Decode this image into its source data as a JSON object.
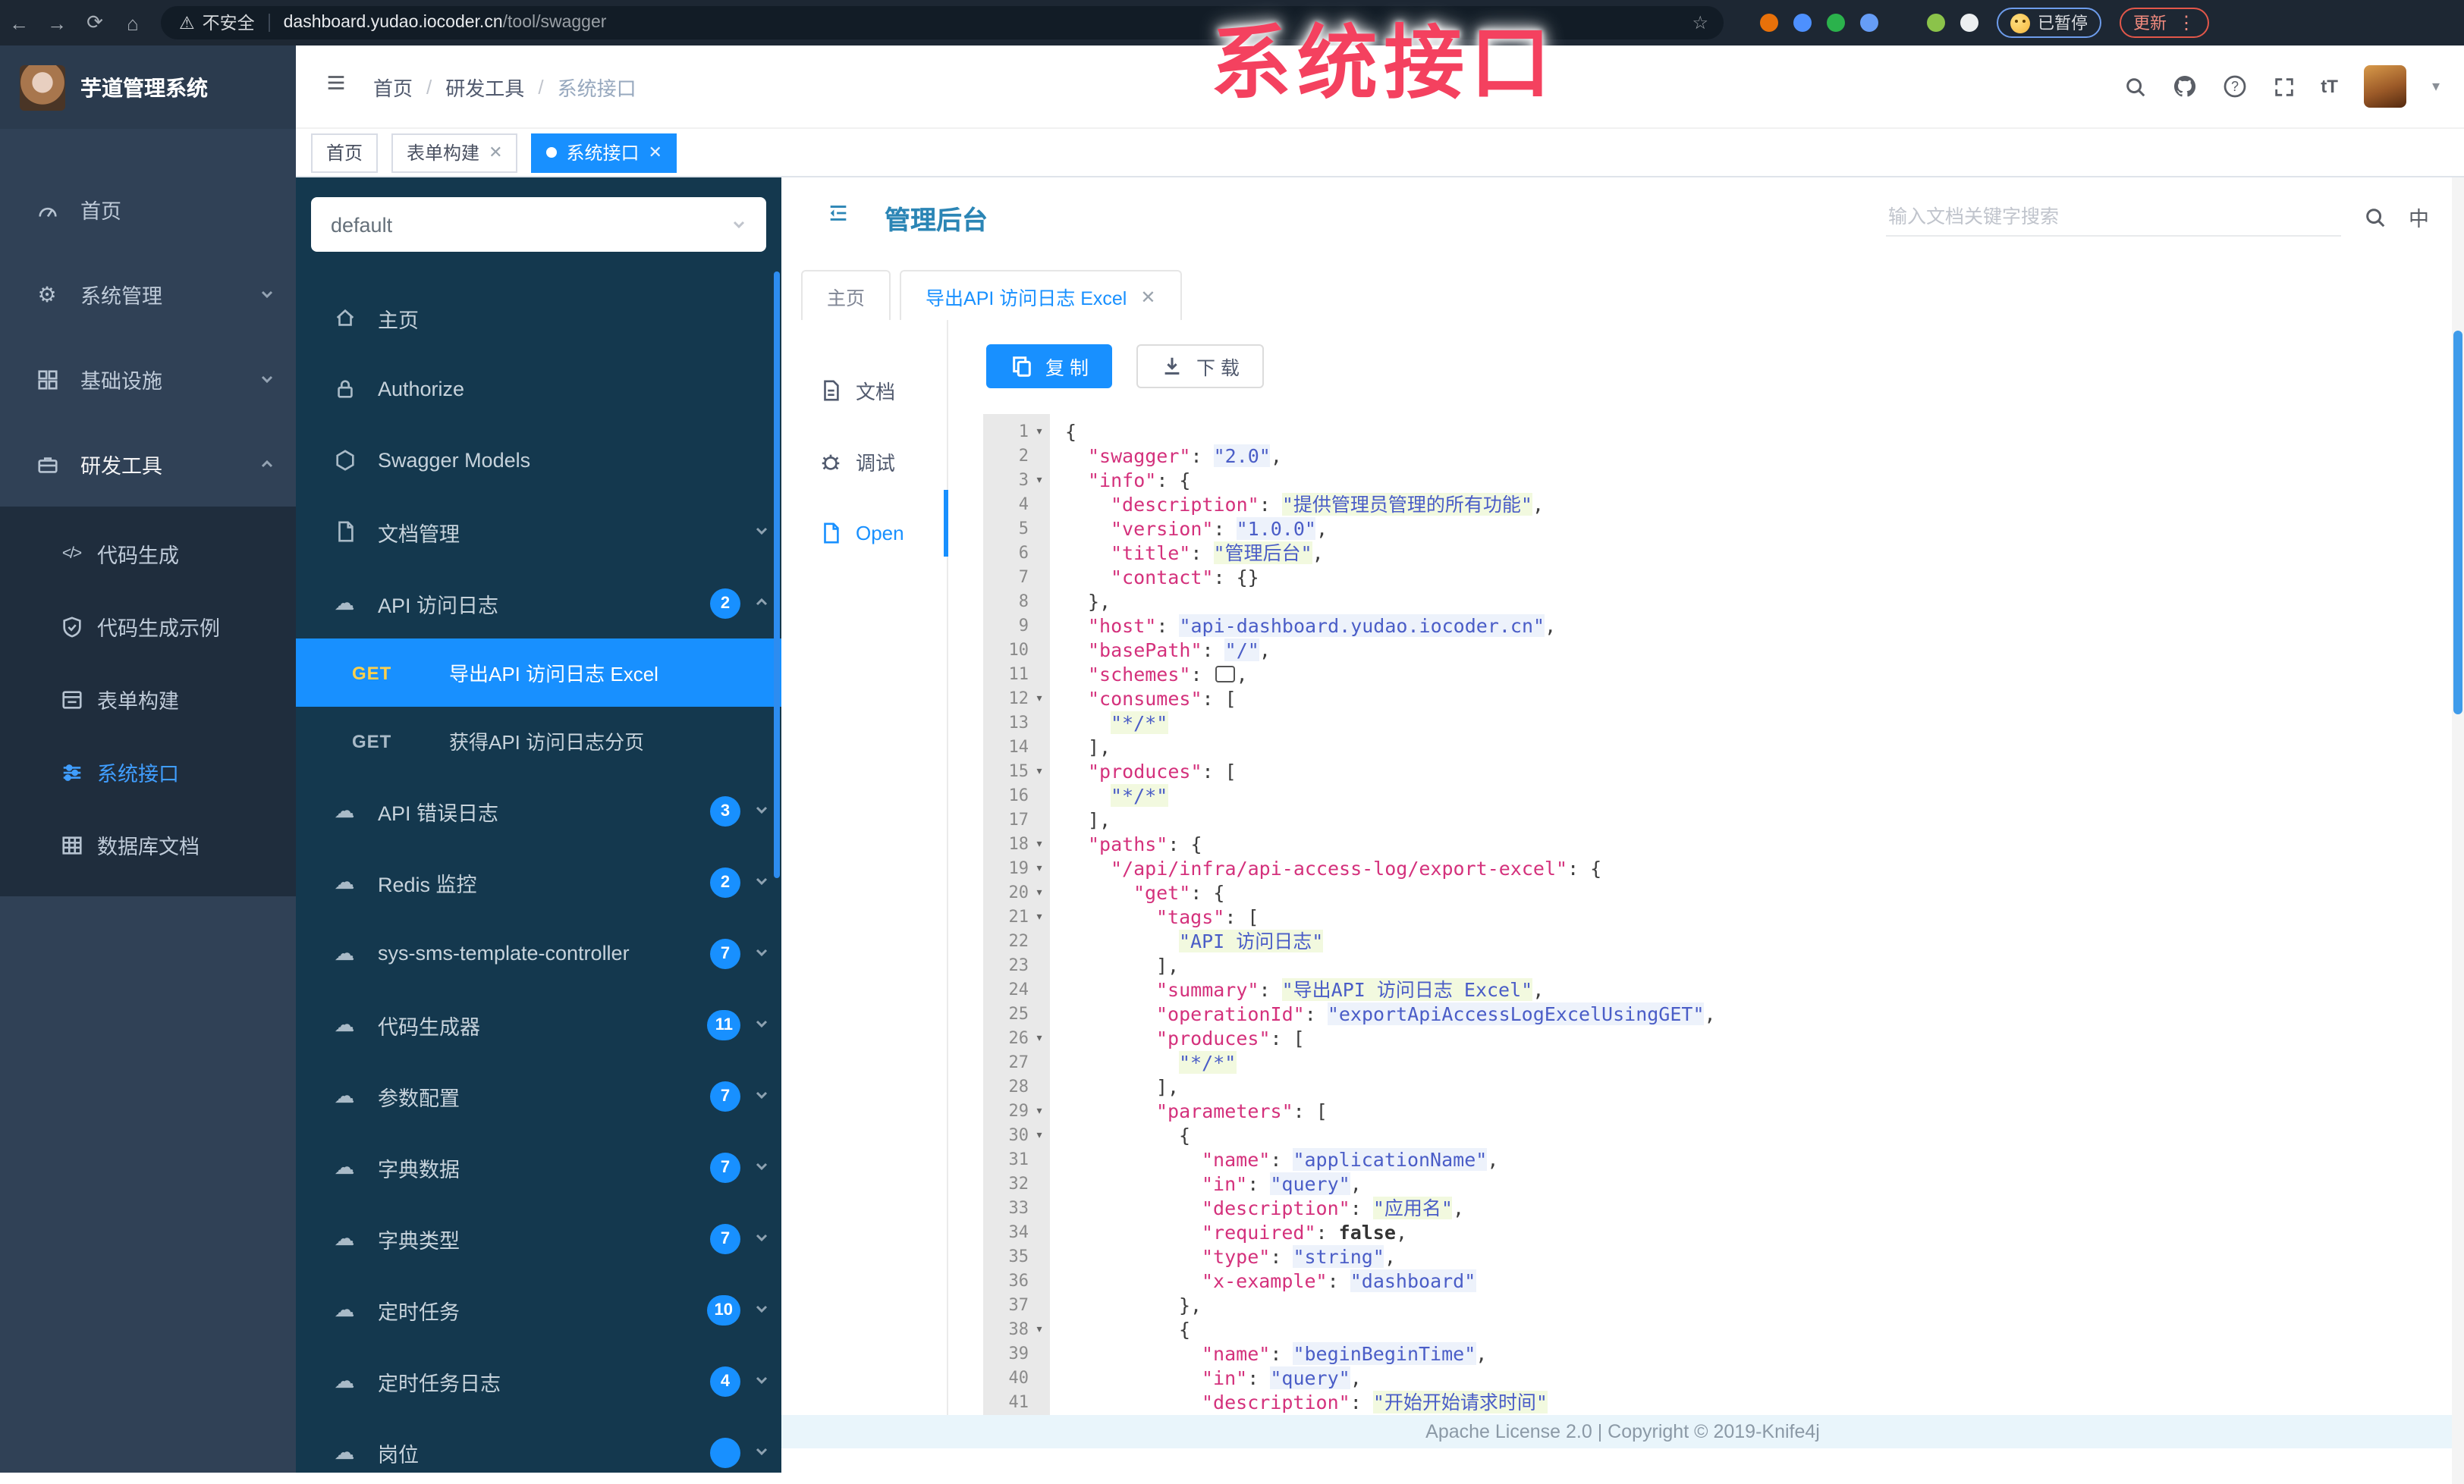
{
  "watermark": "系统接口",
  "colors": {
    "accent": "#1890ff",
    "sidebar_bg": "#304156",
    "submenu_bg": "#1f2d3d",
    "swagger_sidebar_bg": "#14384e",
    "selected_method_text": "#ffd04b",
    "title_teal": "#2b85b5",
    "footer_bg": "#e9f5fb",
    "watermark_pink": "#f4415f",
    "code_key": "#d4317c",
    "code_string": "#4a5dc7"
  },
  "browser": {
    "security_label": "不安全",
    "url_host": "dashboard.yudao.iocoder.cn",
    "url_path": "/tool/swagger",
    "paused_label": "已暂停",
    "update_label": "更新",
    "extensions": [
      {
        "name": "extension-orange-icon",
        "color": "#e8710a"
      },
      {
        "name": "extension-location-icon",
        "color": "#4d90fe"
      },
      {
        "name": "extension-green-ring-icon",
        "color": "#2bb24c"
      },
      {
        "name": "extension-grid-icon",
        "color": "#669df6"
      },
      {
        "name": "extension-green-badge-icon",
        "color": "#12ب886"
      },
      {
        "name": "extension-leaf-icon",
        "color": "#8bc34a"
      },
      {
        "name": "extension-ghost-icon",
        "color": "#eceff1"
      }
    ]
  },
  "app_header": {
    "logo_title": "芋道管理系统",
    "breadcrumb": [
      "首页",
      "研发工具",
      "系统接口"
    ]
  },
  "page_tabs": [
    {
      "label": "首页",
      "closable": false,
      "active": false
    },
    {
      "label": "表单构建",
      "closable": true,
      "active": false
    },
    {
      "label": "系统接口",
      "closable": true,
      "active": true
    }
  ],
  "sidebar": {
    "items": [
      {
        "icon": "dashboard-icon",
        "label": "首页"
      },
      {
        "icon": "gear-icon",
        "label": "系统管理",
        "chevron": "down"
      },
      {
        "icon": "grid-icon",
        "label": "基础设施",
        "chevron": "down"
      },
      {
        "icon": "toolbox-icon",
        "label": "研发工具",
        "chevron": "up",
        "active": true
      }
    ],
    "sub_items": [
      {
        "icon": "code-icon",
        "label": "代码生成"
      },
      {
        "icon": "shield-icon",
        "label": "代码生成示例"
      },
      {
        "icon": "form-icon",
        "label": "表单构建"
      },
      {
        "icon": "sliders-icon",
        "label": "系统接口",
        "active": true
      },
      {
        "icon": "table-icon",
        "label": "数据库文档"
      }
    ]
  },
  "swagger": {
    "group_select": "default",
    "menu": [
      {
        "type": "item",
        "icon": "house-icon",
        "label": "主页"
      },
      {
        "type": "item",
        "icon": "lock-icon",
        "label": "Authorize"
      },
      {
        "type": "item",
        "icon": "models-icon",
        "label": "Swagger Models"
      },
      {
        "type": "item",
        "icon": "file-icon",
        "label": "文档管理",
        "chevron": "down"
      },
      {
        "type": "group",
        "icon": "cloud-icon",
        "label": "API 访问日志",
        "badge": "2",
        "chevron": "up"
      },
      {
        "type": "op",
        "method": "GET",
        "label": "导出API 访问日志 Excel",
        "active": true
      },
      {
        "type": "op",
        "method": "GET",
        "label": "获得API 访问日志分页"
      },
      {
        "type": "group",
        "icon": "cloud-icon",
        "label": "API 错误日志",
        "badge": "3",
        "chevron": "down"
      },
      {
        "type": "group",
        "icon": "cloud-icon",
        "label": "Redis 监控",
        "badge": "2",
        "chevron": "down"
      },
      {
        "type": "group",
        "icon": "cloud-icon",
        "label": "sys-sms-template-controller",
        "badge": "7",
        "chevron": "down"
      },
      {
        "type": "group",
        "icon": "cloud-icon",
        "label": "代码生成器",
        "badge": "11",
        "chevron": "down"
      },
      {
        "type": "group",
        "icon": "cloud-icon",
        "label": "参数配置",
        "badge": "7",
        "chevron": "down"
      },
      {
        "type": "group",
        "icon": "cloud-icon",
        "label": "字典数据",
        "badge": "7",
        "chevron": "down"
      },
      {
        "type": "group",
        "icon": "cloud-icon",
        "label": "字典类型",
        "badge": "7",
        "chevron": "down"
      },
      {
        "type": "group",
        "icon": "cloud-icon",
        "label": "定时任务",
        "badge": "10",
        "chevron": "down"
      },
      {
        "type": "group",
        "icon": "cloud-icon",
        "label": "定时任务日志",
        "badge": "4",
        "chevron": "down"
      },
      {
        "type": "group",
        "icon": "cloud-icon",
        "label": "岗位",
        "badge": "",
        "chevron": "down"
      }
    ]
  },
  "content": {
    "title": "管理后台",
    "search_placeholder": "输入文档关键字搜索",
    "lang": "中",
    "tabs": [
      {
        "label": "主页",
        "closable": false,
        "active": false
      },
      {
        "label": "导出API 访问日志 Excel",
        "closable": true,
        "active": true
      }
    ],
    "doc_tabs": [
      {
        "icon": "doc-icon",
        "label": "文档",
        "active": false
      },
      {
        "icon": "debug-icon",
        "label": "调试",
        "active": false
      },
      {
        "icon": "open-icon",
        "label": "Open",
        "active": true
      }
    ],
    "toolbar": {
      "copy_label": "复 制",
      "download_label": "下 载"
    }
  },
  "code": {
    "lines": [
      {
        "n": 1,
        "i": 0,
        "f": 1,
        "s": [
          [
            "p",
            "{"
          ]
        ]
      },
      {
        "n": 2,
        "i": 1,
        "s": [
          [
            "k",
            "\"swagger\""
          ],
          [
            "p",
            ": "
          ],
          [
            "s",
            "\"2.0\""
          ],
          [
            "p",
            ","
          ]
        ]
      },
      {
        "n": 3,
        "i": 1,
        "f": 1,
        "s": [
          [
            "k",
            "\"info\""
          ],
          [
            "p",
            ": {"
          ]
        ]
      },
      {
        "n": 4,
        "i": 2,
        "s": [
          [
            "k",
            "\"description\""
          ],
          [
            "p",
            ": "
          ],
          [
            "s",
            "\"提供管理员管理的所有功能\""
          ],
          [
            "p",
            ","
          ]
        ]
      },
      {
        "n": 5,
        "i": 2,
        "s": [
          [
            "k",
            "\"version\""
          ],
          [
            "p",
            ": "
          ],
          [
            "s",
            "\"1.0.0\""
          ],
          [
            "p",
            ","
          ]
        ]
      },
      {
        "n": 6,
        "i": 2,
        "s": [
          [
            "k",
            "\"title\""
          ],
          [
            "p",
            ": "
          ],
          [
            "s",
            "\"管理后台\""
          ],
          [
            "p",
            ","
          ]
        ]
      },
      {
        "n": 7,
        "i": 2,
        "s": [
          [
            "k",
            "\"contact\""
          ],
          [
            "p",
            ": {}"
          ]
        ]
      },
      {
        "n": 8,
        "i": 1,
        "s": [
          [
            "p",
            "},"
          ]
        ]
      },
      {
        "n": 9,
        "i": 1,
        "s": [
          [
            "k",
            "\"host\""
          ],
          [
            "p",
            ": "
          ],
          [
            "s",
            "\"api-dashboard.yudao.iocoder.cn\""
          ],
          [
            "p",
            ","
          ]
        ]
      },
      {
        "n": 10,
        "i": 1,
        "s": [
          [
            "k",
            "\"basePath\""
          ],
          [
            "p",
            ": "
          ],
          [
            "s",
            "\"/\""
          ],
          [
            "p",
            ","
          ]
        ]
      },
      {
        "n": 11,
        "i": 1,
        "s": [
          [
            "k",
            "\"schemes\""
          ],
          [
            "p",
            ": "
          ],
          [
            "box",
            ""
          ],
          [
            "p",
            ","
          ]
        ]
      },
      {
        "n": 12,
        "i": 1,
        "f": 1,
        "s": [
          [
            "k",
            "\"consumes\""
          ],
          [
            "p",
            ": ["
          ]
        ]
      },
      {
        "n": 13,
        "i": 2,
        "s": [
          [
            "s",
            "\"*/*\""
          ]
        ]
      },
      {
        "n": 14,
        "i": 1,
        "s": [
          [
            "p",
            "],"
          ]
        ]
      },
      {
        "n": 15,
        "i": 1,
        "f": 1,
        "s": [
          [
            "k",
            "\"produces\""
          ],
          [
            "p",
            ": ["
          ]
        ]
      },
      {
        "n": 16,
        "i": 2,
        "s": [
          [
            "s",
            "\"*/*\""
          ]
        ]
      },
      {
        "n": 17,
        "i": 1,
        "s": [
          [
            "p",
            "],"
          ]
        ]
      },
      {
        "n": 18,
        "i": 1,
        "f": 1,
        "s": [
          [
            "k",
            "\"paths\""
          ],
          [
            "p",
            ": {"
          ]
        ]
      },
      {
        "n": 19,
        "i": 2,
        "f": 1,
        "s": [
          [
            "k",
            "\"/api/infra/api-access-log/export-excel\""
          ],
          [
            "p",
            ": {"
          ]
        ]
      },
      {
        "n": 20,
        "i": 3,
        "f": 1,
        "s": [
          [
            "k",
            "\"get\""
          ],
          [
            "p",
            ": {"
          ]
        ]
      },
      {
        "n": 21,
        "i": 4,
        "f": 1,
        "s": [
          [
            "k",
            "\"tags\""
          ],
          [
            "p",
            ": ["
          ]
        ]
      },
      {
        "n": 22,
        "i": 5,
        "s": [
          [
            "s",
            "\"API 访问日志\""
          ]
        ]
      },
      {
        "n": 23,
        "i": 4,
        "s": [
          [
            "p",
            "],"
          ]
        ]
      },
      {
        "n": 24,
        "i": 4,
        "s": [
          [
            "k",
            "\"summary\""
          ],
          [
            "p",
            ": "
          ],
          [
            "s",
            "\"导出API 访问日志 Excel\""
          ],
          [
            "p",
            ","
          ]
        ]
      },
      {
        "n": 25,
        "i": 4,
        "s": [
          [
            "k",
            "\"operationId\""
          ],
          [
            "p",
            ": "
          ],
          [
            "s",
            "\"exportApiAccessLogExcelUsingGET\""
          ],
          [
            "p",
            ","
          ]
        ]
      },
      {
        "n": 26,
        "i": 4,
        "f": 1,
        "s": [
          [
            "k",
            "\"produces\""
          ],
          [
            "p",
            ": ["
          ]
        ]
      },
      {
        "n": 27,
        "i": 5,
        "s": [
          [
            "s",
            "\"*/*\""
          ]
        ]
      },
      {
        "n": 28,
        "i": 4,
        "s": [
          [
            "p",
            "],"
          ]
        ]
      },
      {
        "n": 29,
        "i": 4,
        "f": 1,
        "s": [
          [
            "k",
            "\"parameters\""
          ],
          [
            "p",
            ": ["
          ]
        ]
      },
      {
        "n": 30,
        "i": 5,
        "f": 1,
        "s": [
          [
            "p",
            "{"
          ]
        ]
      },
      {
        "n": 31,
        "i": 6,
        "s": [
          [
            "k",
            "\"name\""
          ],
          [
            "p",
            ": "
          ],
          [
            "s",
            "\"applicationName\""
          ],
          [
            "p",
            ","
          ]
        ]
      },
      {
        "n": 32,
        "i": 6,
        "s": [
          [
            "k",
            "\"in\""
          ],
          [
            "p",
            ": "
          ],
          [
            "s",
            "\"query\""
          ],
          [
            "p",
            ","
          ]
        ]
      },
      {
        "n": 33,
        "i": 6,
        "s": [
          [
            "k",
            "\"description\""
          ],
          [
            "p",
            ": "
          ],
          [
            "s",
            "\"应用名\""
          ],
          [
            "p",
            ","
          ]
        ]
      },
      {
        "n": 34,
        "i": 6,
        "s": [
          [
            "k",
            "\"required\""
          ],
          [
            "p",
            ": "
          ],
          [
            "b",
            "false"
          ],
          [
            "p",
            ","
          ]
        ]
      },
      {
        "n": 35,
        "i": 6,
        "s": [
          [
            "k",
            "\"type\""
          ],
          [
            "p",
            ": "
          ],
          [
            "s",
            "\"string\""
          ],
          [
            "p",
            ","
          ]
        ]
      },
      {
        "n": 36,
        "i": 6,
        "s": [
          [
            "k",
            "\"x-example\""
          ],
          [
            "p",
            ": "
          ],
          [
            "s",
            "\"dashboard\""
          ]
        ]
      },
      {
        "n": 37,
        "i": 5,
        "s": [
          [
            "p",
            "},"
          ]
        ]
      },
      {
        "n": 38,
        "i": 5,
        "f": 1,
        "s": [
          [
            "p",
            "{"
          ]
        ]
      },
      {
        "n": 39,
        "i": 6,
        "s": [
          [
            "k",
            "\"name\""
          ],
          [
            "p",
            ": "
          ],
          [
            "s",
            "\"beginBeginTime\""
          ],
          [
            "p",
            ","
          ]
        ]
      },
      {
        "n": 40,
        "i": 6,
        "s": [
          [
            "k",
            "\"in\""
          ],
          [
            "p",
            ": "
          ],
          [
            "s",
            "\"query\""
          ],
          [
            "p",
            ","
          ]
        ]
      },
      {
        "n": 41,
        "i": 6,
        "s": [
          [
            "k",
            "\"description\""
          ],
          [
            "p",
            ": "
          ],
          [
            "s",
            "\"开始开始请求时间\""
          ]
        ]
      }
    ]
  },
  "footer": {
    "text": "Apache License 2.0 | Copyright © 2019-Knife4j"
  }
}
